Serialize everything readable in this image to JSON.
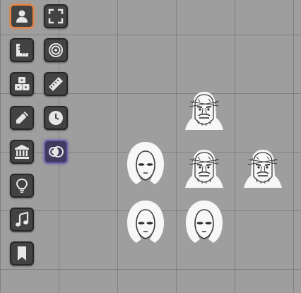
{
  "board": {
    "background_color": "#9e9e9e",
    "grid_color": "#8a8a8a"
  },
  "toolbar": {
    "left_column": [
      {
        "name": "select-token",
        "icon": "person-icon",
        "active": true
      },
      {
        "name": "measure",
        "icon": "ruler-square-icon",
        "active": false
      },
      {
        "name": "dice",
        "icon": "dice-icon",
        "active": false
      },
      {
        "name": "drawing",
        "icon": "pencil-icon",
        "active": false
      },
      {
        "name": "rules",
        "icon": "bank-icon",
        "active": false
      },
      {
        "name": "notes",
        "icon": "lightbulb-icon",
        "active": false
      },
      {
        "name": "audio",
        "icon": "music-note-icon",
        "active": false
      },
      {
        "name": "bookmarks",
        "icon": "bookmark-icon",
        "active": false
      }
    ],
    "right_column": [
      {
        "name": "fullscreen",
        "icon": "fullscreen-icon",
        "active": false
      },
      {
        "name": "target",
        "icon": "target-icon",
        "active": false
      },
      {
        "name": "ruler",
        "icon": "ruler-icon",
        "active": false
      },
      {
        "name": "clock",
        "icon": "clock-icon",
        "active": false
      },
      {
        "name": "fog-toggle",
        "icon": "toggle-circles-icon",
        "active": true
      }
    ],
    "colors": {
      "button_bg": "#434343",
      "icon": "#e6e6e6",
      "active_orange": "#e8823f",
      "active_purple": "#6c63b0"
    }
  },
  "tokens": [
    {
      "type": "bearded-cultist",
      "icon": "bearded-face-icon"
    },
    {
      "type": "hooded-figure",
      "icon": "hooded-figure-icon"
    },
    {
      "type": "bearded-cultist",
      "icon": "bearded-face-icon"
    },
    {
      "type": "bearded-cultist",
      "icon": "bearded-face-icon"
    },
    {
      "type": "hooded-figure",
      "icon": "hooded-figure-icon"
    },
    {
      "type": "hooded-figure",
      "icon": "hooded-figure-icon"
    }
  ]
}
